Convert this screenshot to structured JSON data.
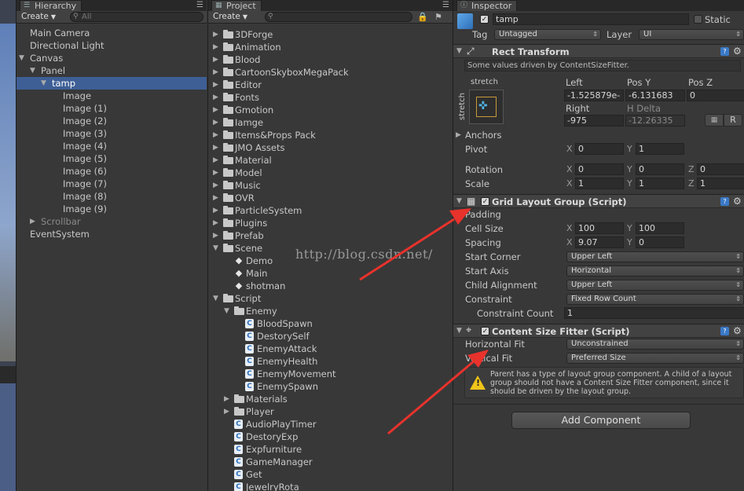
{
  "hierarchy": {
    "tab": "Hierarchy",
    "create": "Create",
    "search_placeholder": "All",
    "items": [
      {
        "label": "Main Camera",
        "depth": 0,
        "expand": "none"
      },
      {
        "label": "Directional Light",
        "depth": 0,
        "expand": "none"
      },
      {
        "label": "Canvas",
        "depth": 0,
        "expand": "open"
      },
      {
        "label": "Panel",
        "depth": 1,
        "expand": "open"
      },
      {
        "label": "tamp",
        "depth": 2,
        "expand": "open",
        "selected": true
      },
      {
        "label": "Image",
        "depth": 3,
        "expand": "none"
      },
      {
        "label": "Image (1)",
        "depth": 3,
        "expand": "none"
      },
      {
        "label": "Image (2)",
        "depth": 3,
        "expand": "none"
      },
      {
        "label": "Image (3)",
        "depth": 3,
        "expand": "none"
      },
      {
        "label": "Image (4)",
        "depth": 3,
        "expand": "none"
      },
      {
        "label": "Image (5)",
        "depth": 3,
        "expand": "none"
      },
      {
        "label": "Image (6)",
        "depth": 3,
        "expand": "none"
      },
      {
        "label": "Image (7)",
        "depth": 3,
        "expand": "none"
      },
      {
        "label": "Image (8)",
        "depth": 3,
        "expand": "none"
      },
      {
        "label": "Image (9)",
        "depth": 3,
        "expand": "none"
      },
      {
        "label": "Scrollbar",
        "depth": 1,
        "expand": "closed",
        "dim": true
      },
      {
        "label": "EventSystem",
        "depth": 0,
        "expand": "none"
      }
    ]
  },
  "project": {
    "tab": "Project",
    "create": "Create",
    "items": [
      {
        "label": "3DForge",
        "depth": 0,
        "kind": "folder",
        "expand": "closed"
      },
      {
        "label": "Animation",
        "depth": 0,
        "kind": "folder",
        "expand": "closed"
      },
      {
        "label": "Blood",
        "depth": 0,
        "kind": "folder",
        "expand": "closed"
      },
      {
        "label": "CartoonSkyboxMegaPack",
        "depth": 0,
        "kind": "folder",
        "expand": "closed"
      },
      {
        "label": "Editor",
        "depth": 0,
        "kind": "folder",
        "expand": "closed"
      },
      {
        "label": "Fonts",
        "depth": 0,
        "kind": "folder",
        "expand": "closed"
      },
      {
        "label": "Gmotion",
        "depth": 0,
        "kind": "folder",
        "expand": "closed"
      },
      {
        "label": "Iamge",
        "depth": 0,
        "kind": "folder",
        "expand": "closed"
      },
      {
        "label": "Items&Props Pack",
        "depth": 0,
        "kind": "folder",
        "expand": "closed"
      },
      {
        "label": "JMO Assets",
        "depth": 0,
        "kind": "folder",
        "expand": "closed"
      },
      {
        "label": "Material",
        "depth": 0,
        "kind": "folder",
        "expand": "closed"
      },
      {
        "label": "Model",
        "depth": 0,
        "kind": "folder",
        "expand": "closed"
      },
      {
        "label": "Music",
        "depth": 0,
        "kind": "folder",
        "expand": "closed"
      },
      {
        "label": "OVR",
        "depth": 0,
        "kind": "folder",
        "expand": "closed"
      },
      {
        "label": "ParticleSystem",
        "depth": 0,
        "kind": "folder",
        "expand": "closed"
      },
      {
        "label": "Plugins",
        "depth": 0,
        "kind": "folder",
        "expand": "closed"
      },
      {
        "label": "Prefab",
        "depth": 0,
        "kind": "folder",
        "expand": "closed"
      },
      {
        "label": "Scene",
        "depth": 0,
        "kind": "folder",
        "expand": "open"
      },
      {
        "label": "Demo",
        "depth": 1,
        "kind": "scene",
        "expand": "none"
      },
      {
        "label": "Main",
        "depth": 1,
        "kind": "scene",
        "expand": "none"
      },
      {
        "label": "shotman",
        "depth": 1,
        "kind": "scene",
        "expand": "none"
      },
      {
        "label": "Script",
        "depth": 0,
        "kind": "folder",
        "expand": "open"
      },
      {
        "label": "Enemy",
        "depth": 1,
        "kind": "folder",
        "expand": "open"
      },
      {
        "label": "BloodSpawn",
        "depth": 2,
        "kind": "script",
        "expand": "none"
      },
      {
        "label": "DestorySelf",
        "depth": 2,
        "kind": "script",
        "expand": "none"
      },
      {
        "label": "EnemyAttack",
        "depth": 2,
        "kind": "script",
        "expand": "none"
      },
      {
        "label": "EnemyHealth",
        "depth": 2,
        "kind": "script",
        "expand": "none"
      },
      {
        "label": "EnemyMovement",
        "depth": 2,
        "kind": "script",
        "expand": "none"
      },
      {
        "label": "EnemySpawn",
        "depth": 2,
        "kind": "script",
        "expand": "none"
      },
      {
        "label": "Materials",
        "depth": 1,
        "kind": "folder",
        "expand": "closed"
      },
      {
        "label": "Player",
        "depth": 1,
        "kind": "folder",
        "expand": "closed"
      },
      {
        "label": "AudioPlayTimer",
        "depth": 1,
        "kind": "script",
        "expand": "none"
      },
      {
        "label": "DestoryExp",
        "depth": 1,
        "kind": "script",
        "expand": "none"
      },
      {
        "label": "Expfurniture",
        "depth": 1,
        "kind": "script",
        "expand": "none"
      },
      {
        "label": "GameManager",
        "depth": 1,
        "kind": "script",
        "expand": "none"
      },
      {
        "label": "Get",
        "depth": 1,
        "kind": "script",
        "expand": "none"
      },
      {
        "label": "JewelryRota",
        "depth": 1,
        "kind": "script",
        "expand": "none"
      }
    ]
  },
  "inspector": {
    "tab": "Inspector",
    "object_name": "tamp",
    "static_label": "Static",
    "tag_label": "Tag",
    "tag_value": "Untagged",
    "layer_label": "Layer",
    "layer_value": "UI",
    "rect": {
      "title": "Rect Transform",
      "note": "Some values driven by ContentSizeFitter.",
      "anchor_preset": "stretch",
      "anchor_side": "stretch",
      "left_label": "Left",
      "posy_label": "Pos Y",
      "posz_label": "Pos Z",
      "left_value": "-1.525879e-",
      "posy_value": "-6.131683",
      "posz_value": "0",
      "right_label": "Right",
      "hdelta_label": "H Delta",
      "right_value": "-975",
      "hdelta_value": "-12.26335",
      "r_button": "R",
      "anchors_label": "Anchors",
      "pivot_label": "Pivot",
      "pivot_x": "0",
      "pivot_y": "1",
      "rotation_label": "Rotation",
      "rot_x": "0",
      "rot_y": "0",
      "rot_z": "0",
      "scale_label": "Scale",
      "scale_x": "1",
      "scale_y": "1",
      "scale_z": "1"
    },
    "grid": {
      "title": "Grid Layout Group (Script)",
      "padding_label": "Padding",
      "cell_label": "Cell Size",
      "cell_x": "100",
      "cell_y": "100",
      "spacing_label": "Spacing",
      "spacing_x": "9.07",
      "spacing_y": "0",
      "start_corner_label": "Start Corner",
      "start_corner": "Upper Left",
      "start_axis_label": "Start Axis",
      "start_axis": "Horizontal",
      "child_align_label": "Child Alignment",
      "child_align": "Upper Left",
      "constraint_label": "Constraint",
      "constraint": "Fixed Row Count",
      "constraint_count_label": "Constraint Count",
      "constraint_count": "1"
    },
    "fitter": {
      "title": "Content Size Fitter (Script)",
      "hfit_label": "Horizontal Fit",
      "hfit": "Unconstrained",
      "vfit_label": "Vertical Fit",
      "vfit": "Preferred Size",
      "warning": "Parent has a type of layout group component. A child of a layout group should not have a Content Size Fitter component, since it should be driven by the layout group."
    },
    "add_component": "Add Component",
    "axis_x": "X",
    "axis_y": "Y",
    "axis_z": "Z"
  },
  "watermark": "http://blog.csdn.net/",
  "colors": {
    "selection": "#3e5f96",
    "annotation_arrow": "#e8322c",
    "help_icon": "#3a79c7"
  }
}
